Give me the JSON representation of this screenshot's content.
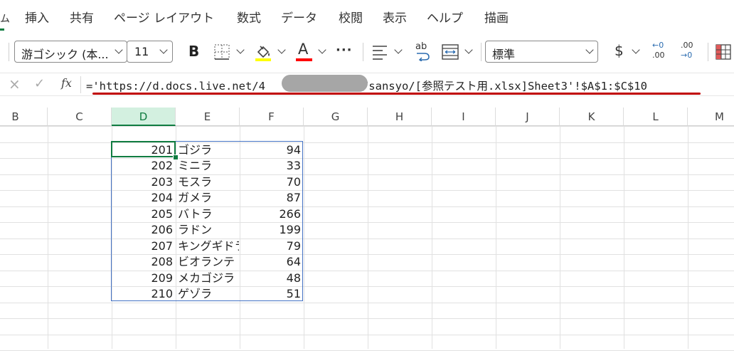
{
  "menu": {
    "home_fragment": "ム",
    "items": [
      "挿入",
      "共有",
      "ページ レイアウト",
      "数式",
      "データ",
      "校閲",
      "表示",
      "ヘルプ",
      "描画"
    ]
  },
  "ribbon": {
    "font_name": "游ゴシック (本...",
    "font_size": "11",
    "bold_label": "B",
    "font_color_label": "A",
    "more_label": "···",
    "number_format": "標準",
    "currency_label": "$",
    "inc_decimal_top": "←0",
    "inc_decimal_bottom": ".00",
    "dec_decimal_top": ".00",
    "dec_decimal_bottom": "→0",
    "wrap_label": "ab"
  },
  "formula_bar": {
    "cancel_icon": "×",
    "enter_icon": "✓",
    "fx_label": "fx",
    "formula_prefix": "='https://d.docs.live.net/4",
    "formula_suffix": "39d/sansyo/[参照テスト用.xlsx]Sheet3'!$A$1:$C$10"
  },
  "columns": [
    "B",
    "C",
    "D",
    "E",
    "F",
    "G",
    "H",
    "I",
    "J",
    "K",
    "L",
    "M"
  ],
  "selected_column": "D",
  "rows": [
    {
      "id": "201",
      "name": "ゴジラ",
      "value": "94"
    },
    {
      "id": "202",
      "name": "ミニラ",
      "value": "33"
    },
    {
      "id": "203",
      "name": "モスラ",
      "value": "70"
    },
    {
      "id": "204",
      "name": "ガメラ",
      "value": "87"
    },
    {
      "id": "205",
      "name": "バトラ",
      "value": "266"
    },
    {
      "id": "206",
      "name": "ラドン",
      "value": "199"
    },
    {
      "id": "207",
      "name": "キングギドラ",
      "value": "79"
    },
    {
      "id": "208",
      "name": "ビオランテ",
      "value": "64"
    },
    {
      "id": "209",
      "name": "メカゴジラ",
      "value": "48"
    },
    {
      "id": "210",
      "name": "ゲゾラ",
      "value": "51"
    }
  ],
  "colors": {
    "accent_green": "#107c41",
    "highlight_yellow": "#ffff00",
    "font_red": "#ff0000",
    "range_blue": "#4472c4",
    "annotation_red": "#c00000"
  }
}
